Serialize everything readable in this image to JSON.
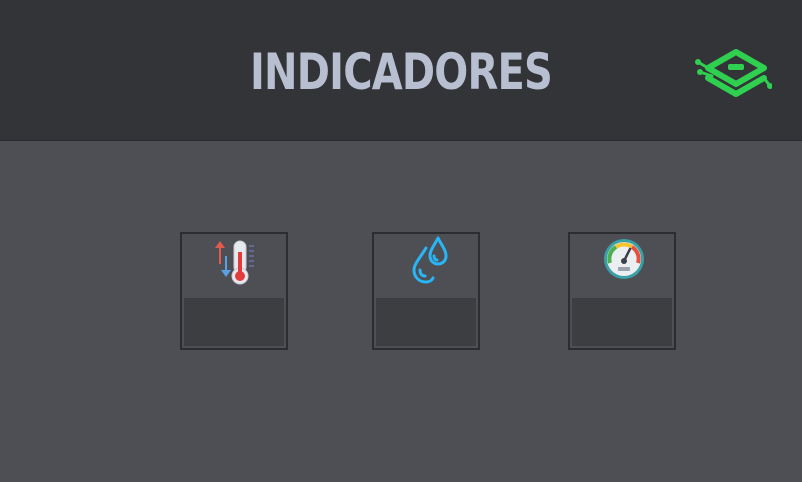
{
  "header": {
    "title": "INDICADORES",
    "logo_icon": "circuit-hexagon-logo-icon",
    "logo_color": "#2fcf4f"
  },
  "indicators": [
    {
      "icon": "thermometer-icon",
      "value": ""
    },
    {
      "icon": "humidity-drops-icon",
      "value": ""
    },
    {
      "icon": "pressure-gauge-icon",
      "value": ""
    }
  ],
  "colors": {
    "header_bg": "#333438",
    "page_bg": "#4d4f55",
    "title": "#b8bfd0",
    "value_bg": "#3d3e42"
  }
}
